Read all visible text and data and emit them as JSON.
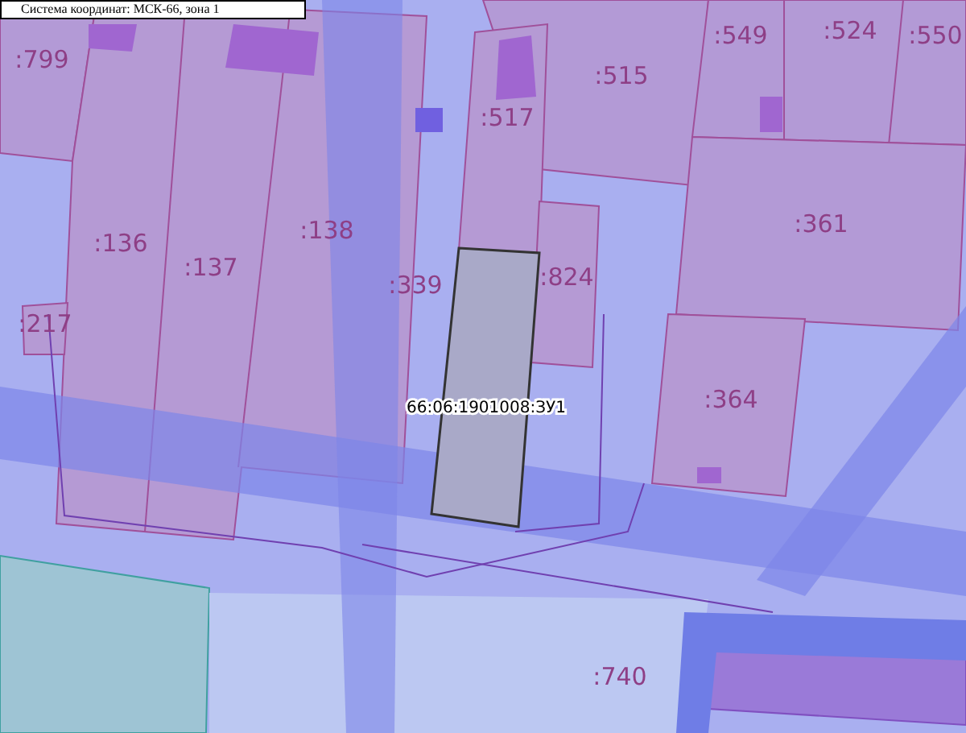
{
  "legend": {
    "text": "Система координат: МСК-66, зона 1"
  },
  "parcels": [
    {
      "label": ":799"
    },
    {
      "label": ":549"
    },
    {
      "label": ":524"
    },
    {
      "label": ":550"
    },
    {
      "label": ":515"
    },
    {
      "label": ":517"
    },
    {
      "label": ":136"
    },
    {
      "label": ":137"
    },
    {
      "label": ":138"
    },
    {
      "label": ":361"
    },
    {
      "label": ":339"
    },
    {
      "label": ":824"
    },
    {
      "label": ":217"
    },
    {
      "label": ":364"
    },
    {
      "label": ":740"
    }
  ],
  "selected_parcel": {
    "label": "66:06:1901008:ЗУ1"
  }
}
